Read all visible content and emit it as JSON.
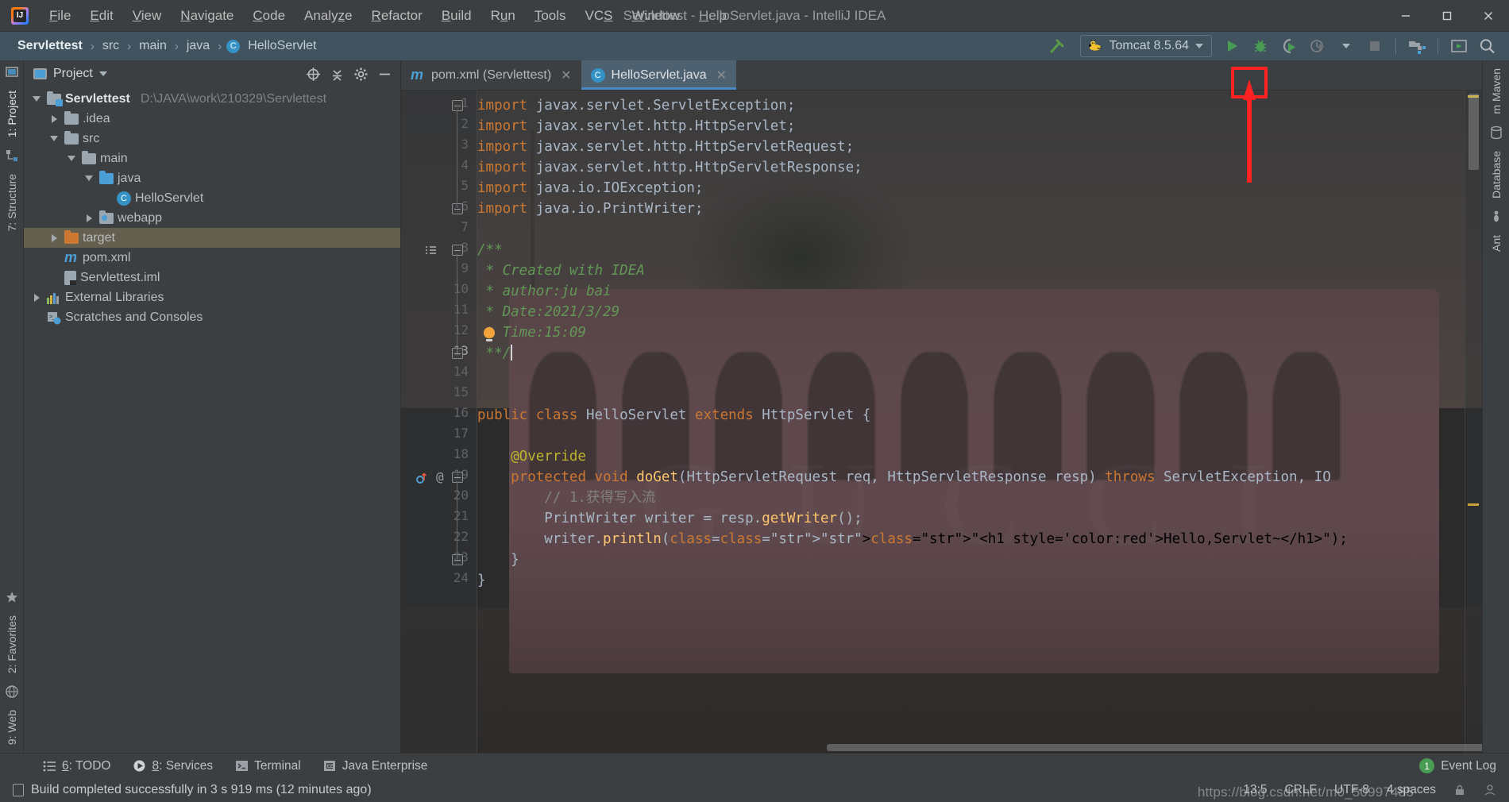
{
  "window": {
    "title": "Servlettest - HelloServlet.java - IntelliJ IDEA",
    "logo_text": "IJ",
    "minimize": "—",
    "maximize": "☐",
    "close": "✕"
  },
  "menubar": {
    "items": [
      {
        "label": "File",
        "mnemonic": "F"
      },
      {
        "label": "Edit",
        "mnemonic": "E"
      },
      {
        "label": "View",
        "mnemonic": "V"
      },
      {
        "label": "Navigate",
        "mnemonic": "N"
      },
      {
        "label": "Code",
        "mnemonic": "C"
      },
      {
        "label": "Analyze",
        "mnemonic": "z"
      },
      {
        "label": "Refactor",
        "mnemonic": "R"
      },
      {
        "label": "Build",
        "mnemonic": "B"
      },
      {
        "label": "Run",
        "mnemonic": "u"
      },
      {
        "label": "Tools",
        "mnemonic": "T"
      },
      {
        "label": "VCS",
        "mnemonic": "S"
      },
      {
        "label": "Window",
        "mnemonic": "W"
      },
      {
        "label": "Help",
        "mnemonic": "H"
      }
    ]
  },
  "navbar": {
    "breadcrumbs": [
      "Servlettest",
      "src",
      "main",
      "java",
      "HelloServlet"
    ],
    "separator": "›",
    "class_icon_letter": "C",
    "run_config": {
      "name": "Tomcat 8.5.64",
      "icon": "tomcat-icon"
    },
    "buttons": [
      {
        "name": "build-hammer-icon",
        "title": "Build Project"
      },
      {
        "name": "run-button",
        "title": "Run"
      },
      {
        "name": "debug-button",
        "title": "Debug"
      },
      {
        "name": "run-with-coverage-button",
        "title": "Run with Coverage"
      },
      {
        "name": "profiler-button",
        "title": "Profiler"
      },
      {
        "name": "stop-button",
        "title": "Stop"
      },
      {
        "name": "project-structure-button",
        "title": "Project Structure"
      },
      {
        "name": "updates-button",
        "title": "Updates"
      },
      {
        "name": "search-everywhere-button",
        "title": "Search Everywhere"
      }
    ]
  },
  "left_rail": {
    "items": [
      "1: Project",
      "7: Structure"
    ],
    "bottom_items": [
      "2: Favorites",
      "9: Web"
    ]
  },
  "right_rail": {
    "items": [
      "m Maven",
      "Database",
      "Ant"
    ]
  },
  "project_panel": {
    "title": "Project",
    "tree": [
      {
        "indent": 0,
        "twisty": "down",
        "icon": "folder-module",
        "label": "Servlettest",
        "bold": true,
        "path": "D:\\JAVA\\work\\210329\\Servlettest",
        "selected": false
      },
      {
        "indent": 1,
        "twisty": "right",
        "icon": "folder",
        "label": ".idea",
        "bold": false,
        "path": "",
        "selected": false
      },
      {
        "indent": 1,
        "twisty": "down",
        "icon": "folder",
        "label": "src",
        "bold": false,
        "path": "",
        "selected": false
      },
      {
        "indent": 2,
        "twisty": "down",
        "icon": "folder",
        "label": "main",
        "bold": false,
        "path": "",
        "selected": false
      },
      {
        "indent": 3,
        "twisty": "down",
        "icon": "folder-source",
        "label": "java",
        "bold": false,
        "path": "",
        "selected": false
      },
      {
        "indent": 4,
        "twisty": "none",
        "icon": "class",
        "label": "HelloServlet",
        "bold": false,
        "path": "",
        "selected": false
      },
      {
        "indent": 3,
        "twisty": "right",
        "icon": "folder-web",
        "label": "webapp",
        "bold": false,
        "path": "",
        "selected": false
      },
      {
        "indent": 1,
        "twisty": "right",
        "icon": "folder-excluded",
        "label": "target",
        "bold": false,
        "path": "",
        "selected": true
      },
      {
        "indent": 1,
        "twisty": "none",
        "icon": "maven",
        "label": "pom.xml",
        "bold": false,
        "path": "",
        "selected": false
      },
      {
        "indent": 1,
        "twisty": "none",
        "icon": "iml",
        "label": "Servlettest.iml",
        "bold": false,
        "path": "",
        "selected": false
      },
      {
        "indent": 0,
        "twisty": "right",
        "icon": "library",
        "label": "External Libraries",
        "bold": false,
        "path": "",
        "selected": false
      },
      {
        "indent": 0,
        "twisty": "none",
        "icon": "scratches",
        "label": "Scratches and Consoles",
        "bold": false,
        "path": "",
        "selected": false
      }
    ]
  },
  "editor": {
    "tabs": [
      {
        "label": "pom.xml (Servlettest)",
        "icon": "maven-icon",
        "active": false,
        "close": "✕"
      },
      {
        "label": "HelloServlet.java",
        "icon": "class-icon",
        "active": true,
        "close": "✕"
      }
    ],
    "lines": [
      {
        "n": 1,
        "text": "import javax.servlet.ServletException;"
      },
      {
        "n": 2,
        "text": "import javax.servlet.http.HttpServlet;"
      },
      {
        "n": 3,
        "text": "import javax.servlet.http.HttpServletRequest;"
      },
      {
        "n": 4,
        "text": "import javax.servlet.http.HttpServletResponse;"
      },
      {
        "n": 5,
        "text": "import java.io.IOException;"
      },
      {
        "n": 6,
        "text": "import java.io.PrintWriter;"
      },
      {
        "n": 7,
        "text": ""
      },
      {
        "n": 8,
        "text": "/**"
      },
      {
        "n": 9,
        "text": " * Created with IDEA"
      },
      {
        "n": 10,
        "text": " * author:ju bai"
      },
      {
        "n": 11,
        "text": " * Date:2021/3/29"
      },
      {
        "n": 12,
        "text": " * Time:15:09"
      },
      {
        "n": 13,
        "text": " **/"
      },
      {
        "n": 14,
        "text": ""
      },
      {
        "n": 15,
        "text": ""
      },
      {
        "n": 16,
        "text": "public class HelloServlet extends HttpServlet {"
      },
      {
        "n": 17,
        "text": ""
      },
      {
        "n": 18,
        "text": "    @Override"
      },
      {
        "n": 19,
        "text": "    protected void doGet(HttpServletRequest req, HttpServletResponse resp) throws ServletException, IO"
      },
      {
        "n": 20,
        "text": "        // 1.获得写入流"
      },
      {
        "n": 21,
        "text": "        PrintWriter writer = resp.getWriter();"
      },
      {
        "n": 22,
        "text": "        writer.println(\"<h1 style='color:red'>Hello,Servlet~</h1>\");"
      },
      {
        "n": 23,
        "text": "    }"
      },
      {
        "n": 24,
        "text": "}"
      }
    ],
    "cursor_line": 13
  },
  "bottom_bar": {
    "items": [
      {
        "label": "6: TODO",
        "mnemonic": "6",
        "icon": "todo-icon"
      },
      {
        "label": "8: Services",
        "mnemonic": "8",
        "icon": "services-icon"
      },
      {
        "label": "Terminal",
        "mnemonic": "",
        "icon": "terminal-icon"
      },
      {
        "label": "Java Enterprise",
        "mnemonic": "",
        "icon": "java-ee-icon"
      }
    ],
    "event_log": {
      "label": "Event Log",
      "count": "1"
    }
  },
  "status_bar": {
    "message": "Build completed successfully in 3 s 919 ms (12 minutes ago)",
    "caret": "13:5",
    "line_separator": "CRLF",
    "encoding": "UTF-8",
    "indent": "4 spaces",
    "watermark": "https://blog.csdn.net/m0_50997485"
  },
  "colors": {
    "accent": "#4a88c7",
    "run_green": "#499c54",
    "highlight_red": "#ff2222",
    "navbar_bg": "#41535f",
    "editor_bg": "#2b2b2b",
    "keyword": "#cc7832",
    "string": "#6a8759",
    "comment": "#629755",
    "annotation": "#bbb529",
    "method": "#ffc66d",
    "plain": "#a9b7c6",
    "selected_row": "rgba(160,140,100,0.42)"
  }
}
